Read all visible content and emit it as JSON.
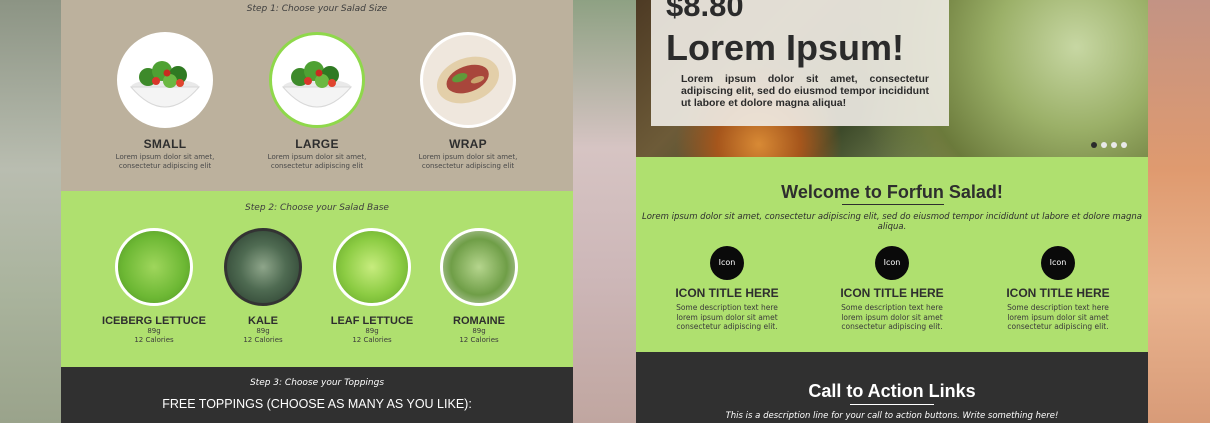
{
  "builder": {
    "step1": "Step 1: Choose your Salad Size",
    "sizes": [
      {
        "name": "SMALL",
        "desc": "Lorem ipsum dolor sit amet, consectetur adipiscing elit",
        "selected": false,
        "icon": "salad-bowl-image"
      },
      {
        "name": "LARGE",
        "desc": "Lorem ipsum dolor sit amet, consectetur adipiscing elit",
        "selected": true,
        "icon": "salad-bowl-image"
      },
      {
        "name": "WRAP",
        "desc": "Lorem ipsum dolor sit amet, consectetur adipiscing elit",
        "selected": false,
        "icon": "wrap-image"
      }
    ],
    "step2": "Step 2: Choose your Salad Base",
    "bases": [
      {
        "name": "ICEBERG LETTUCE",
        "grams": "89g",
        "calories": "12 Calories",
        "selected": false
      },
      {
        "name": "KALE",
        "grams": "89g",
        "calories": "12 Calories",
        "selected": true
      },
      {
        "name": "LEAF LETTUCE",
        "grams": "89g",
        "calories": "12 Calories",
        "selected": false
      },
      {
        "name": "ROMAINE",
        "grams": "89g",
        "calories": "12 Calories",
        "selected": false
      }
    ],
    "step3": "Step 3: Choose your Toppings",
    "toppings_title": "FREE TOPPINGS (CHOOSE AS MANY AS YOU LIKE):"
  },
  "landing": {
    "hero": {
      "price": "$8.80",
      "title": "Lorem Ipsum!",
      "body": "Lorem ipsum dolor sit amet, consectetur adipiscing elit, sed do eiusmod tempor incididunt ut labore et dolore magna aliqua!",
      "slides": 4,
      "active_slide": 0
    },
    "welcome": {
      "title": "Welcome to Forfun Salad!",
      "subtitle": "Lorem ipsum dolor sit amet, consectetur adipiscing elit, sed do eiusmod tempor incididunt ut labore et dolore magna aliqua."
    },
    "features": [
      {
        "icon": "Icon",
        "title": "ICON TITLE HERE",
        "desc": "Some description text here lorem ipsum dolor sit amet consectetur adipiscing elit."
      },
      {
        "icon": "Icon",
        "title": "ICON TITLE HERE",
        "desc": "Some description text here lorem ipsum dolor sit amet consectetur adipiscing elit."
      },
      {
        "icon": "Icon",
        "title": "ICON TITLE HERE",
        "desc": "Some description text here lorem ipsum dolor sit amet consectetur adipiscing elit."
      }
    ],
    "cta": {
      "title": "Call to Action Links",
      "subtitle": "This is a description line for your call to action buttons. Write something here!"
    }
  },
  "colors": {
    "accent_green": "#afe06f",
    "tan": "#bcb19d",
    "dark": "#303030",
    "selected_ring": "#8fd84b"
  }
}
